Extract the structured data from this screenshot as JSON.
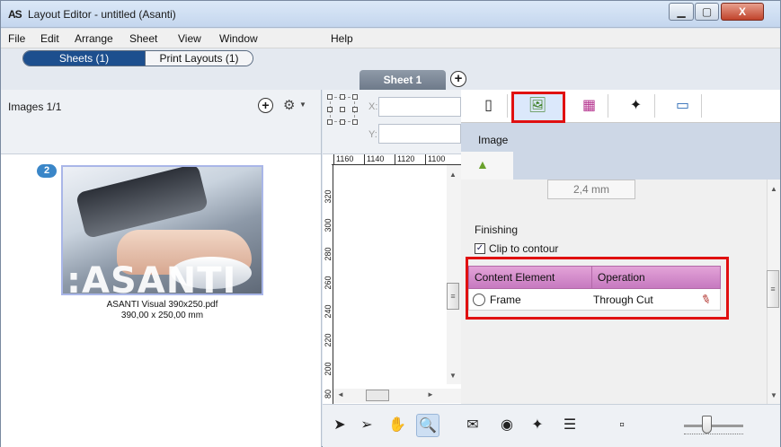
{
  "window": {
    "app_icon": "AS",
    "title": "Layout Editor - untitled (Asanti)",
    "minimize_icon": "minimize-icon",
    "maximize_icon": "maximize-icon",
    "close_icon": "close-icon",
    "minimize_glyph": "▁",
    "maximize_glyph": "▢",
    "close_glyph": "X"
  },
  "menu": [
    "File",
    "Edit",
    "Arrange",
    "Sheet",
    "View",
    "Window",
    "Help"
  ],
  "views": {
    "sheets_label": "Sheets (1)",
    "print_layouts_label": "Print Layouts (1)"
  },
  "sheet_tab": {
    "label": "Sheet 1",
    "add_glyph": "+"
  },
  "left_panel": {
    "images_count": "Images 1/1",
    "add_glyph": "+",
    "gear_glyph": "⚙",
    "gear_arrow": "▼",
    "badge": "2",
    "thumbnail_logo": ":ASANTI",
    "file_name": "ASANTI Visual 390x250.pdf",
    "file_size": "390,00 x 250,00 mm"
  },
  "canvas": {
    "x_label": "X:",
    "y_label": "Y:",
    "ruler_top": [
      "1160",
      "1140",
      "1120",
      "1100"
    ],
    "ruler_left": [
      "320",
      "300",
      "280",
      "260",
      "240",
      "220",
      "200",
      "80"
    ],
    "scroll_up": "▲",
    "scroll_down": "▼",
    "scroll_left": "◄",
    "scroll_right": "►",
    "grip": "≡"
  },
  "right_panel": {
    "toolbar_icons": [
      {
        "name": "document-icon",
        "glyph": "▯"
      },
      {
        "name": "image-icon",
        "glyph": "🖼"
      },
      {
        "name": "color-swatch-icon",
        "glyph": "▦"
      },
      {
        "name": "crosshair-icon",
        "glyph": "✦"
      },
      {
        "name": "frame-icon",
        "glyph": "▭"
      }
    ],
    "panel_title": "Image",
    "sub_icon": "image-small-icon",
    "sub_glyph": "▲",
    "size_value": "2,4 mm",
    "finishing_label": "Finishing",
    "clip_label": "Clip to contour",
    "clip_checked": "✓",
    "table": {
      "headers": [
        "Content Element",
        "Operation"
      ],
      "rows": [
        {
          "element": "Frame",
          "operation": "Through Cut"
        }
      ]
    },
    "pen_glyph": "✎",
    "scroll_up": "▲",
    "scroll_down": "▼",
    "grip": "≡"
  },
  "bottom_toolbar": [
    {
      "name": "select-arrow-icon",
      "glyph": "➤"
    },
    {
      "name": "direct-select-icon",
      "glyph": "➢"
    },
    {
      "name": "hand-icon",
      "glyph": "✋"
    },
    {
      "name": "zoom-icon",
      "glyph": "🔍"
    },
    {
      "name": "envelope-icon",
      "glyph": "✉"
    },
    {
      "name": "eye-icon",
      "glyph": "◉"
    },
    {
      "name": "center-icon",
      "glyph": "✦"
    },
    {
      "name": "sliders-icon",
      "glyph": "☰"
    },
    {
      "name": "zoom-out-icon",
      "glyph": "▫"
    }
  ],
  "colors": {
    "accent": "#1d4f8e",
    "highlight_red": "#e01010",
    "table_header": "#c679c0"
  }
}
